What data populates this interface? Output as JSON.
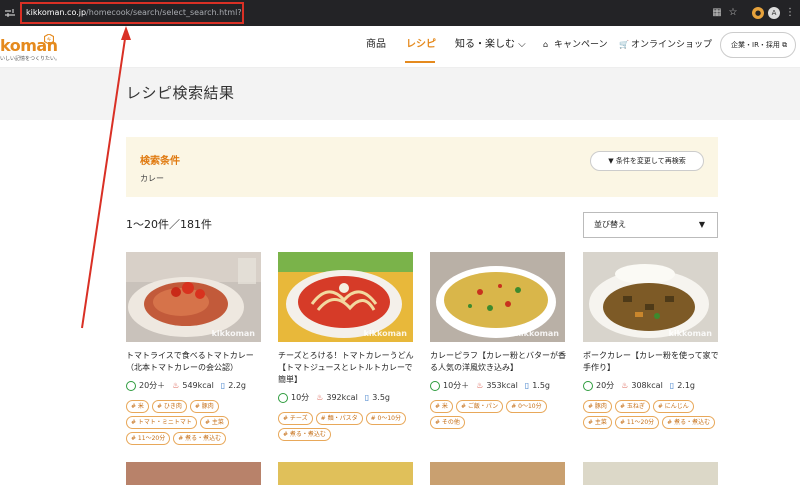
{
  "browser": {
    "url_domain": "kikkoman.co.jp",
    "url_path": "/homecook/search/select_search.html?kw=カレー"
  },
  "header": {
    "logo_text": "koman",
    "logo_sub": "いしい記憶をつくりたい。",
    "nav": [
      {
        "label": "商品",
        "active": false
      },
      {
        "label": "レシピ",
        "active": true
      },
      {
        "label": "知る・楽しむ ⌵",
        "active": false
      },
      {
        "label": "キャンペーン",
        "active": false
      },
      {
        "label": "オンラインショップ",
        "active": false
      }
    ],
    "corp_button": "企業・IR・採用 ⧉"
  },
  "page_title": "レシピ検索結果",
  "search_conditions": {
    "title": "検索条件",
    "value": "カレー",
    "change_button": "▼ 条件を変更して再検索"
  },
  "results": {
    "count_text": "1〜20件／181件",
    "sort_label": "並び替え"
  },
  "recipes": [
    {
      "title": "トマトライスで食べるトマトカレー（北本トマトカレーの会公認）",
      "time": "20分＋",
      "kcal": "549kcal",
      "salt": "2.2g",
      "tags": [
        "# 米",
        "# ひき肉",
        "# 豚肉",
        "# トマト・ミニトマト",
        "# 主菜",
        "# 11〜20分",
        "# 煮る・煮込む"
      ]
    },
    {
      "title": "チーズとろける！トマトカレーうどん【トマトジュースとレトルトカレーで簡単】",
      "time": "10分",
      "kcal": "392kcal",
      "salt": "3.5g",
      "tags": [
        "# チーズ",
        "# 麺・パスタ",
        "# 0〜10分",
        "# 煮る・煮込む"
      ]
    },
    {
      "title": "カレーピラフ【カレー粉とバターが香る人気の洋風炊き込み】",
      "time": "10分＋",
      "kcal": "353kcal",
      "salt": "1.5g",
      "tags": [
        "# 米",
        "# ご飯・パン",
        "# 0〜10分",
        "# その他"
      ]
    },
    {
      "title": "ポークカレー【カレー粉を使って家で手作り】",
      "time": "20分",
      "kcal": "308kcal",
      "salt": "2.1g",
      "tags": [
        "# 豚肉",
        "# 玉ねぎ",
        "# にんじん",
        "# 主菜",
        "# 11〜20分",
        "# 煮る・煮込む"
      ]
    }
  ],
  "watermark": "kikkoman",
  "colors": {
    "brand_orange": "#e58a1e",
    "annotation_red": "#d93025",
    "condition_bg": "#fbf6e4"
  }
}
